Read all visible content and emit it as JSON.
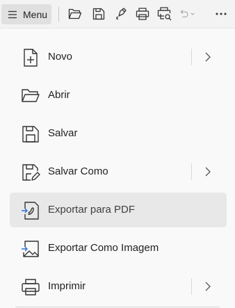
{
  "toolbar": {
    "menu_label": "Menu",
    "icons": [
      "open-folder-icon",
      "save-icon",
      "pen-sign-icon",
      "print-icon",
      "print-preview-icon",
      "undo-icon",
      "more-icon"
    ]
  },
  "menu": {
    "items": [
      {
        "label": "Novo",
        "icon": "new-file-icon",
        "submenu": true
      },
      {
        "label": "Abrir",
        "icon": "folder-icon",
        "submenu": false
      },
      {
        "label": "Salvar",
        "icon": "save-icon",
        "submenu": false
      },
      {
        "label": "Salvar Como",
        "icon": "save-as-icon",
        "submenu": true
      },
      {
        "label": "Exportar para PDF",
        "icon": "export-pdf-icon",
        "submenu": false,
        "hovered": true
      },
      {
        "label": "Exportar Como Imagem",
        "icon": "export-image-icon",
        "submenu": false
      },
      {
        "label": "Imprimir",
        "icon": "print-icon",
        "submenu": true
      }
    ]
  },
  "colors": {
    "accent": "#2f6fd6",
    "hover": "#e8e8e8",
    "icon": "#3a3a3a"
  }
}
